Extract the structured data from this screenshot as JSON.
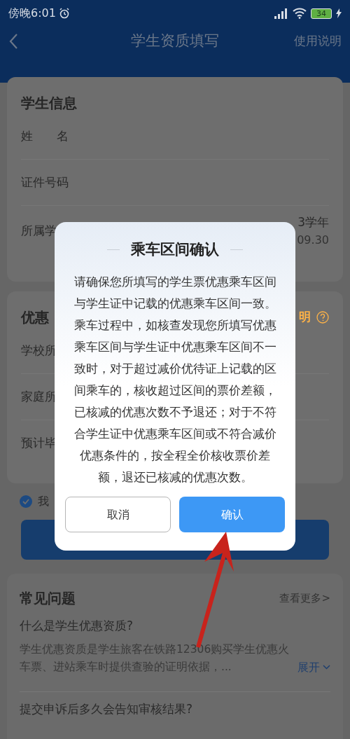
{
  "status_bar": {
    "time": "傍晚6:01",
    "battery": "34"
  },
  "nav": {
    "title": "学生资质填写",
    "action": "使用说明"
  },
  "student_info": {
    "title": "学生信息",
    "rows": [
      {
        "label": "姓　　名"
      },
      {
        "label": "证件号码"
      },
      {
        "label": "所属学",
        "value_lines": [
          "3学年",
          "09.30"
        ]
      }
    ]
  },
  "discount_info": {
    "title": "优惠",
    "help": "明",
    "rows": [
      {
        "label": "学校所"
      },
      {
        "label": "家庭所"
      },
      {
        "label": "预计毕"
      }
    ]
  },
  "agreement": {
    "checked": true,
    "label": "我"
  },
  "faq": {
    "title": "常见问题",
    "more": "查看更多>",
    "items": [
      {
        "question": "什么是学生优惠资质?",
        "answer": "学生优惠资质是学生旅客在铁路12306购买学生优惠火车票、进站乘车时提供查验的证明依据，...",
        "expand": "展开"
      },
      {
        "question": "提交申诉后多久会告知审核结果?"
      }
    ]
  },
  "dialog": {
    "title": "乘车区间确认",
    "message": "请确保您所填写的学生票优惠乘车区间与学生证中记载的优惠乘车区间一致。乘车过程中，如核查发现您所填写优惠乘车区间与学生证中优惠乘车区间不一致时，对于超过减价优待证上记载的区间乘车的，核收超过区间的票价差额，已核减的优惠次数不予退还；对于不符合学生证中优惠乘车区间或不符合减价优惠条件的，按全程全价核收票价差额，退还已核减的优惠次数。",
    "buttons": [
      {
        "label": "取消",
        "kind": "secondary"
      },
      {
        "label": "确认",
        "kind": "primary"
      }
    ]
  }
}
